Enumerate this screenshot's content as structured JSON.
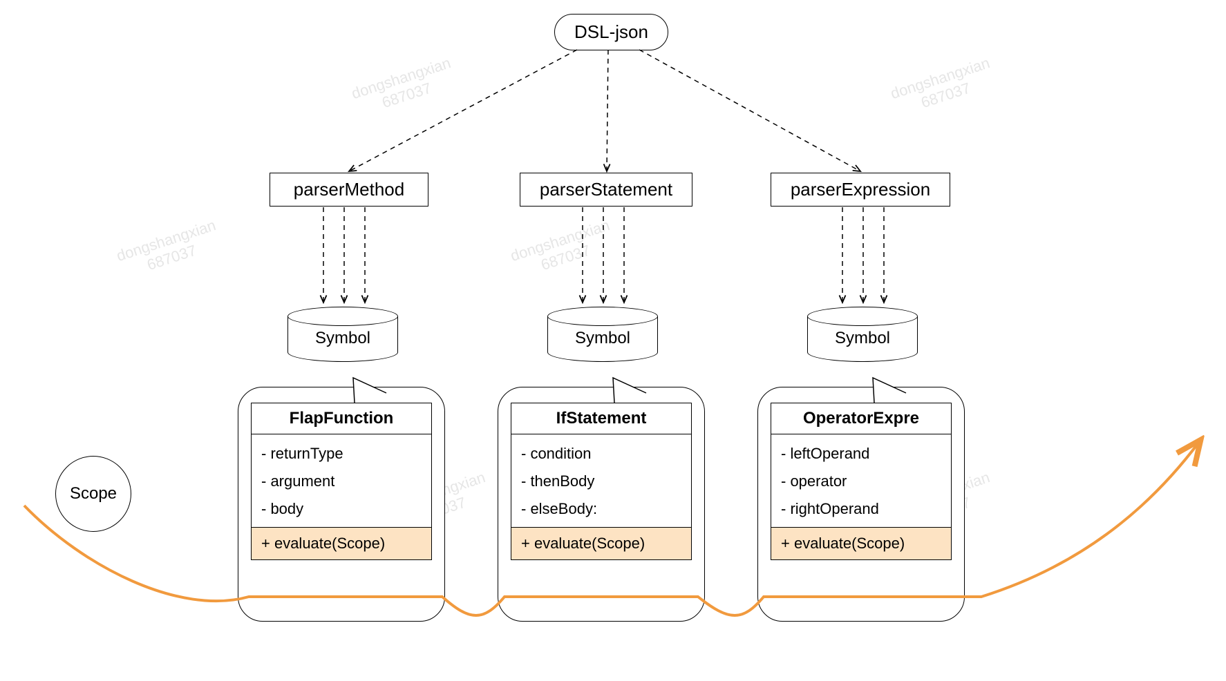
{
  "root": "DSL-json",
  "parsers": {
    "method": "parserMethod",
    "statement": "parserStatement",
    "expression": "parserExpression"
  },
  "symbolLabel": "Symbol",
  "classes": {
    "flap": {
      "name": "FlapFunction",
      "fields": [
        "- returnType",
        "- argument",
        "- body"
      ],
      "method": "+ evaluate(Scope)"
    },
    "ifstmt": {
      "name": "IfStatement",
      "fields": [
        "- condition",
        "- thenBody",
        "- elseBody:"
      ],
      "method": "+ evaluate(Scope)"
    },
    "opexpr": {
      "name": "OperatorExpre",
      "fields": [
        "- leftOperand",
        "- operator",
        "- rightOperand"
      ],
      "method": "+ evaluate(Scope)"
    }
  },
  "scopeLabel": "Scope",
  "watermark": {
    "line1": "dongshangxian",
    "line2": "687037"
  },
  "colors": {
    "arrowOrange": "#f19a3e",
    "methodBg": "#fde3c3"
  }
}
